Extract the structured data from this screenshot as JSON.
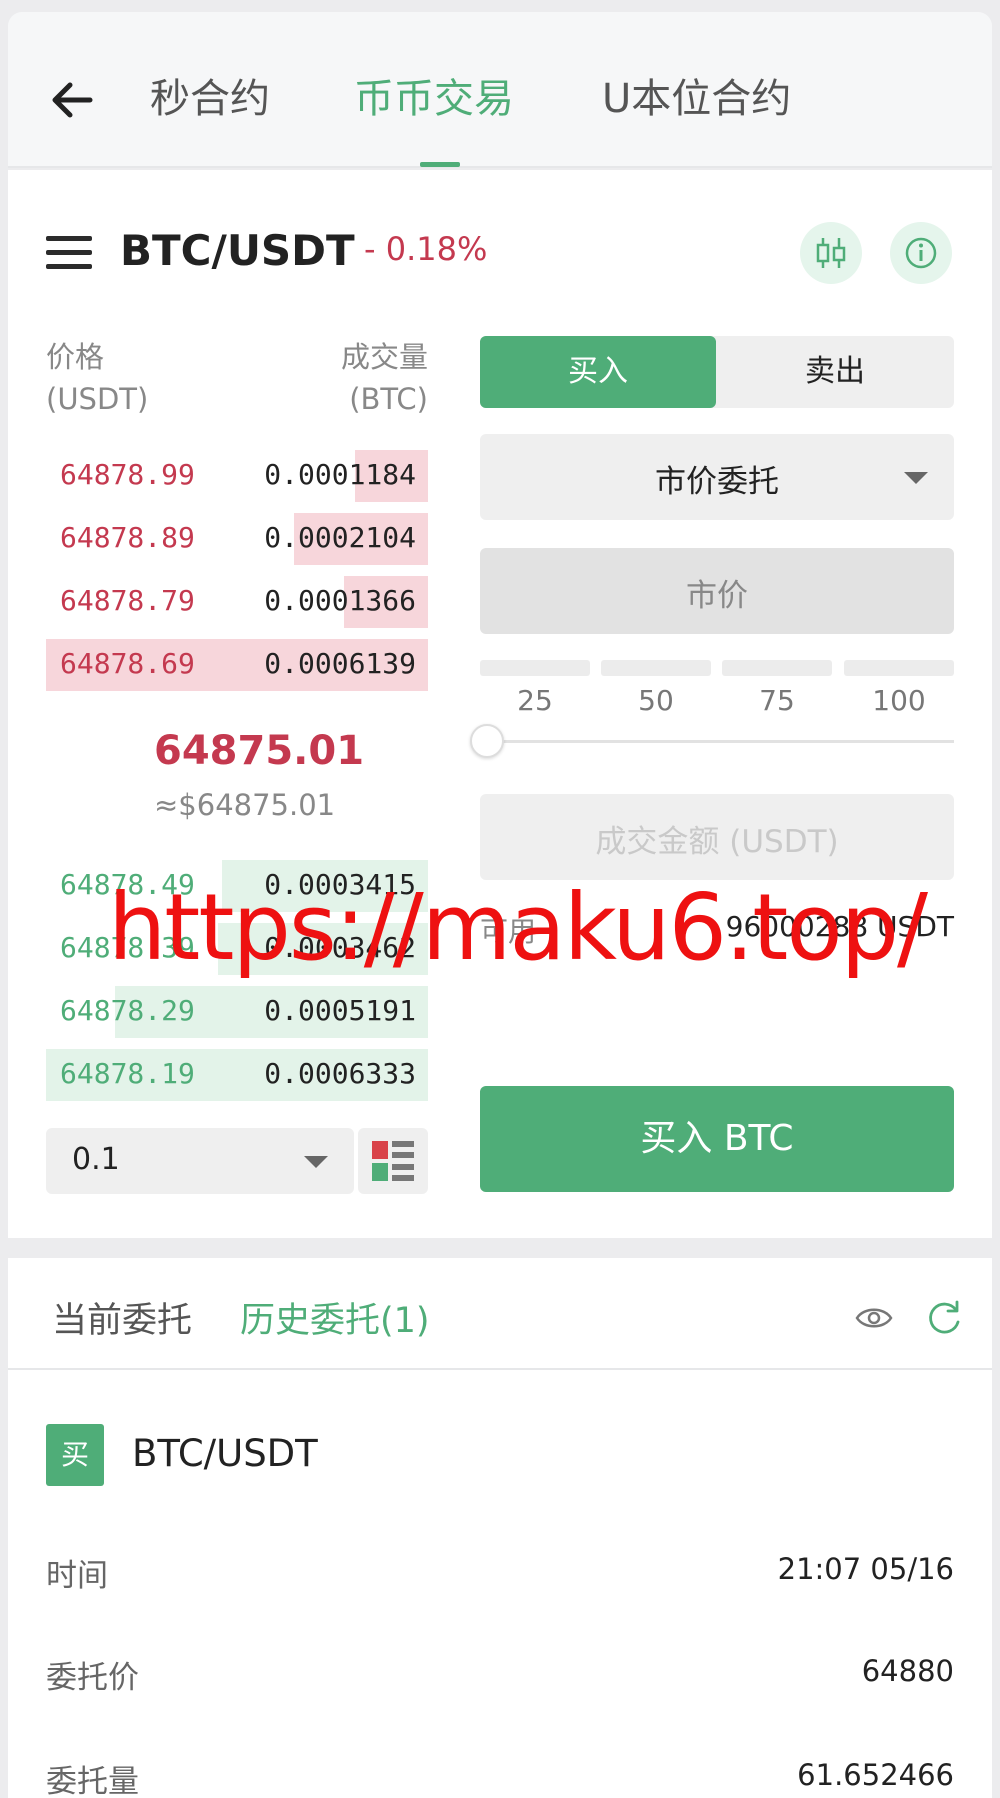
{
  "nav": {
    "tabs": [
      "秒合约",
      "币币交易",
      "U本位合约"
    ],
    "active_tab": "币币交易"
  },
  "ticker": {
    "pair": "BTC/USDT",
    "change": "- 0.18%"
  },
  "orderbook": {
    "price_header": [
      "价格",
      "(USDT)"
    ],
    "qty_header": [
      "成交量",
      "(BTC)"
    ],
    "asks": [
      {
        "price": "64878.99",
        "qty": "0.0001184",
        "depth": 0.19
      },
      {
        "price": "64878.89",
        "qty": "0.0002104",
        "depth": 0.35
      },
      {
        "price": "64878.79",
        "qty": "0.0001366",
        "depth": 0.22
      },
      {
        "price": "64878.69",
        "qty": "0.0006139",
        "depth": 1.0
      }
    ],
    "last_price": "64875.01",
    "last_price_usd": "≈$64875.01",
    "bids": [
      {
        "price": "64878.49",
        "qty": "0.0003415",
        "depth": 0.54
      },
      {
        "price": "64878.39",
        "qty": "0.0003462",
        "depth": 0.55
      },
      {
        "price": "64878.29",
        "qty": "0.0005191",
        "depth": 0.82
      },
      {
        "price": "64878.19",
        "qty": "0.0006333",
        "depth": 1.0
      }
    ],
    "depth_precision": "0.1"
  },
  "trade_form": {
    "buy_label": "买入",
    "sell_label": "卖出",
    "order_type": "市价委托",
    "price_placeholder": "市价",
    "percent_options": [
      "25",
      "50",
      "75",
      "100"
    ],
    "slider_value": 0,
    "amount_placeholder": "成交金额 (USDT)",
    "available_label": "可用",
    "available_value": "96000288 USDT",
    "submit_label": "买入 BTC"
  },
  "watermark": "https://maku6.top/",
  "orders": {
    "tabs": [
      "当前委托",
      "历史委托(1)"
    ],
    "active_tab": "历史委托(1)",
    "item": {
      "side_badge": "买",
      "pair": "BTC/USDT",
      "rows": [
        {
          "label": "时间",
          "value": "21:07 05/16"
        },
        {
          "label": "委托价",
          "value": "64880"
        },
        {
          "label": "委托量",
          "value": "61.652466"
        }
      ]
    }
  },
  "colors": {
    "accent_green": "#4fad78",
    "down_red": "#c4394f",
    "ask_bg": "#f7d6db",
    "bid_bg": "#e3f3e9"
  },
  "icons": [
    "back-arrow-icon",
    "menu-icon",
    "kline-icon",
    "info-icon",
    "caret-down-icon",
    "orderbook-layout-icon",
    "eye-icon",
    "refresh-icon"
  ]
}
